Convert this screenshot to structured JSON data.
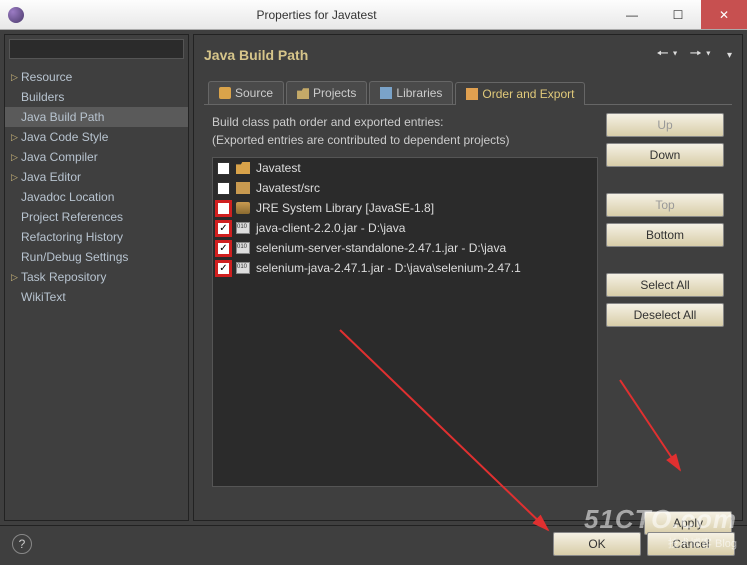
{
  "window": {
    "title": "Properties for Javatest"
  },
  "sidebar": {
    "items": [
      {
        "label": "Resource",
        "expandable": true
      },
      {
        "label": "Builders",
        "expandable": false
      },
      {
        "label": "Java Build Path",
        "expandable": false,
        "selected": true
      },
      {
        "label": "Java Code Style",
        "expandable": true
      },
      {
        "label": "Java Compiler",
        "expandable": true
      },
      {
        "label": "Java Editor",
        "expandable": true
      },
      {
        "label": "Javadoc Location",
        "expandable": false
      },
      {
        "label": "Project References",
        "expandable": false
      },
      {
        "label": "Refactoring History",
        "expandable": false
      },
      {
        "label": "Run/Debug Settings",
        "expandable": false
      },
      {
        "label": "Task Repository",
        "expandable": true
      },
      {
        "label": "WikiText",
        "expandable": false
      }
    ]
  },
  "main": {
    "heading": "Java Build Path",
    "tabs": {
      "source": "Source",
      "projects": "Projects",
      "libraries": "Libraries",
      "order": "Order and Export"
    },
    "desc1": "Build class path order and exported entries:",
    "desc2": "(Exported entries are contributed to dependent projects)",
    "entries": [
      {
        "checked": false,
        "hl": false,
        "icon": "folder",
        "label": "Javatest"
      },
      {
        "checked": false,
        "hl": false,
        "icon": "pkg",
        "label": "Javatest/src"
      },
      {
        "checked": false,
        "hl": true,
        "icon": "jre",
        "label": "JRE System Library [JavaSE-1.8]"
      },
      {
        "checked": true,
        "hl": true,
        "icon": "jar",
        "label": "java-client-2.2.0.jar - D:\\java"
      },
      {
        "checked": true,
        "hl": true,
        "icon": "jar",
        "label": "selenium-server-standalone-2.47.1.jar - D:\\java"
      },
      {
        "checked": true,
        "hl": true,
        "icon": "jar",
        "label": "selenium-java-2.47.1.jar - D:\\java\\selenium-2.47.1"
      }
    ],
    "buttons": {
      "up": "Up",
      "down": "Down",
      "top": "Top",
      "bottom": "Bottom",
      "selectAll": "Select All",
      "deselectAll": "Deselect All",
      "apply": "Apply"
    }
  },
  "footer": {
    "ok": "OK",
    "cancel": "Cancel"
  },
  "watermark": {
    "line1": "51CTO.com",
    "line2": "技术博客    Blog"
  }
}
